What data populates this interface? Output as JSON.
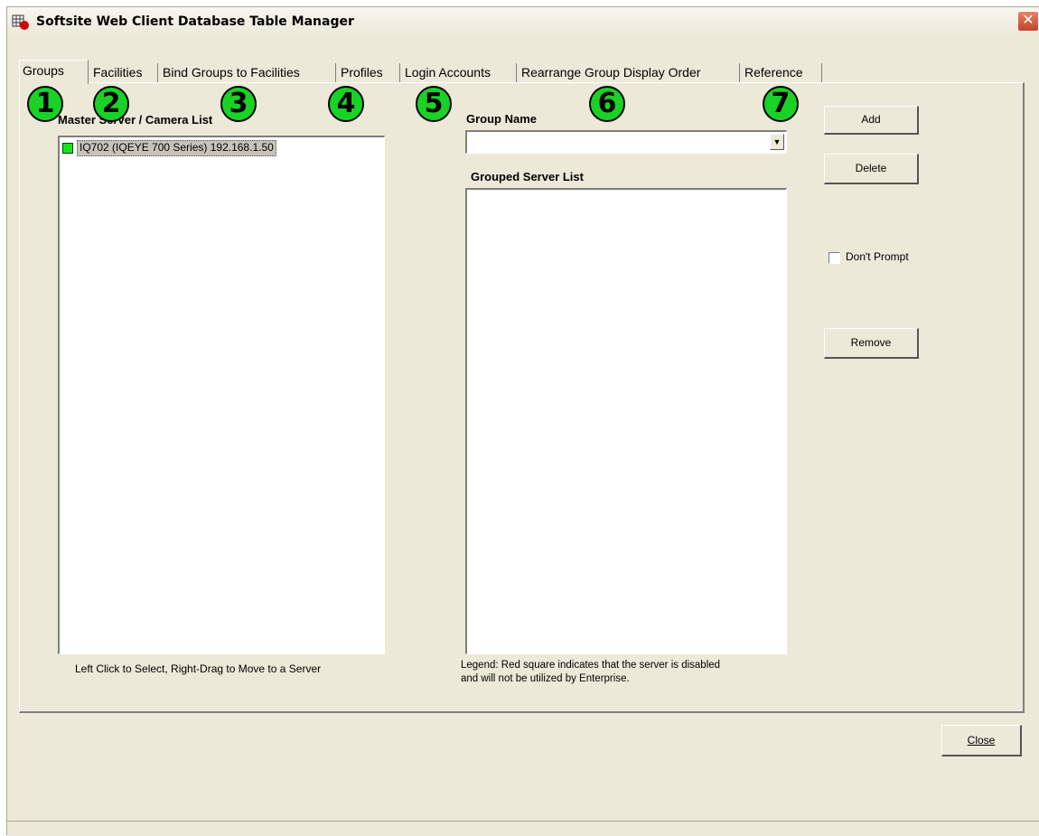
{
  "window": {
    "title": "Softsite Web Client Database Table Manager"
  },
  "tabs": [
    {
      "label": "Groups"
    },
    {
      "label": "Facilities"
    },
    {
      "label": "Bind Groups to Facilities"
    },
    {
      "label": "Profiles"
    },
    {
      "label": "Login Accounts"
    },
    {
      "label": "Rearrange Group Display Order"
    },
    {
      "label": "Reference"
    }
  ],
  "markers": [
    "1",
    "2",
    "3",
    "4",
    "5",
    "6",
    "7"
  ],
  "master_list": {
    "heading": "Master Server / Camera List",
    "items": [
      {
        "label": "IQ702 (IQEYE 700 Series) 192.168.1.50",
        "status": "enabled"
      }
    ],
    "hint": "Left Click to Select, Right-Drag to Move to a Server"
  },
  "group": {
    "name_label": "Group Name",
    "name_value": "",
    "server_list_label": "Grouped Server List",
    "legend_line1": "Legend: Red square indicates that the server is disabled",
    "legend_line2": "and will not be utilized by Enterprise."
  },
  "buttons": {
    "add": "Add",
    "delete": "Delete",
    "remove": "Remove",
    "close": "Close"
  },
  "dont_prompt": {
    "label": "Don't Prompt",
    "checked": false
  },
  "colors": {
    "marker": "#19d225",
    "enabled_square": "#19e21f",
    "close_button": "#c2432a"
  }
}
